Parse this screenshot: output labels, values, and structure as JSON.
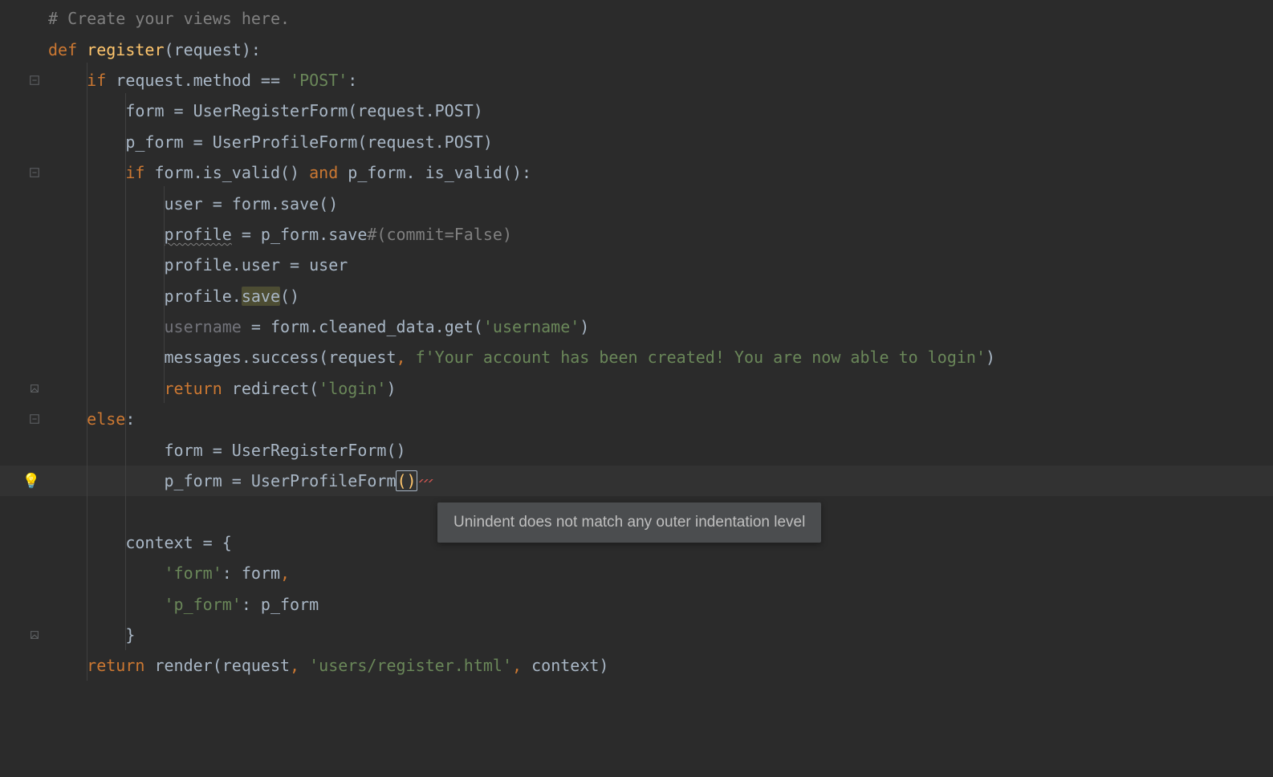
{
  "tooltip": {
    "text": "Unindent does not match any outer indentation level"
  },
  "gutter_icons": {
    "bulb": "lightbulb-icon"
  },
  "code": {
    "l1": {
      "comment": "# Create your views here."
    },
    "l2": {
      "kw1": "def ",
      "fn": "register",
      "rest": "(request):"
    },
    "l3": {
      "indent": "    ",
      "kw": "if ",
      "txt1": "request.method == ",
      "str": "'POST'",
      "colon": ":"
    },
    "l4": {
      "indent": "        ",
      "txt": "form = UserRegisterForm(request.POST)"
    },
    "l5": {
      "indent": "        ",
      "txt": "p_form = UserProfileForm(request.POST)"
    },
    "l6": {
      "indent": "        ",
      "kw1": "if ",
      "txt1": "form.is_valid() ",
      "kw2": "and ",
      "txt2": "p_form. is_valid():"
    },
    "l7": {
      "indent": "            ",
      "txt": "user = form.save()"
    },
    "l8": {
      "indent": "            ",
      "u": "profile",
      "txt1": " = p_form.save",
      "cmt": "#(commit=False)"
    },
    "l9": {
      "indent": "            ",
      "txt": "profile.user = user"
    },
    "l10": {
      "indent": "            ",
      "txt1": "profile.",
      "mark": "save",
      "txt2": "()"
    },
    "l11": {
      "indent": "            ",
      "dim": "username",
      "txt1": " = form.cleaned_data.get(",
      "str": "'username'",
      "txt2": ")"
    },
    "l12": {
      "indent": "            ",
      "txt1": "messages.success(request",
      "comma": ", ",
      "str": "f'Your account has been created! You are now able to login'",
      "txt2": ")"
    },
    "l13": {
      "indent": "            ",
      "kw": "return ",
      "txt1": "redirect(",
      "str": "'login'",
      "txt2": ")"
    },
    "l14": {
      "indent": "    ",
      "kw": "else",
      "colon": ":"
    },
    "l15": {
      "indent": "            ",
      "txt": "form = UserRegisterForm()"
    },
    "l16": {
      "indent": "            ",
      "txt1": "p_form = UserProfileForm",
      "paren": "()"
    },
    "l17": {
      "indent": ""
    },
    "l18": {
      "indent": "        ",
      "txt": "context = {"
    },
    "l19": {
      "indent": "            ",
      "str": "'form'",
      "txt": ": form",
      "comma": ","
    },
    "l20": {
      "indent": "            ",
      "str": "'p_form'",
      "txt": ": p_form"
    },
    "l21": {
      "indent": "        ",
      "txt": "}"
    },
    "l22": {
      "indent": "    ",
      "kw": "return ",
      "txt1": "render(request",
      "comma1": ", ",
      "str": "'users/register.html'",
      "comma2": ", ",
      "txt2": "context)"
    }
  }
}
